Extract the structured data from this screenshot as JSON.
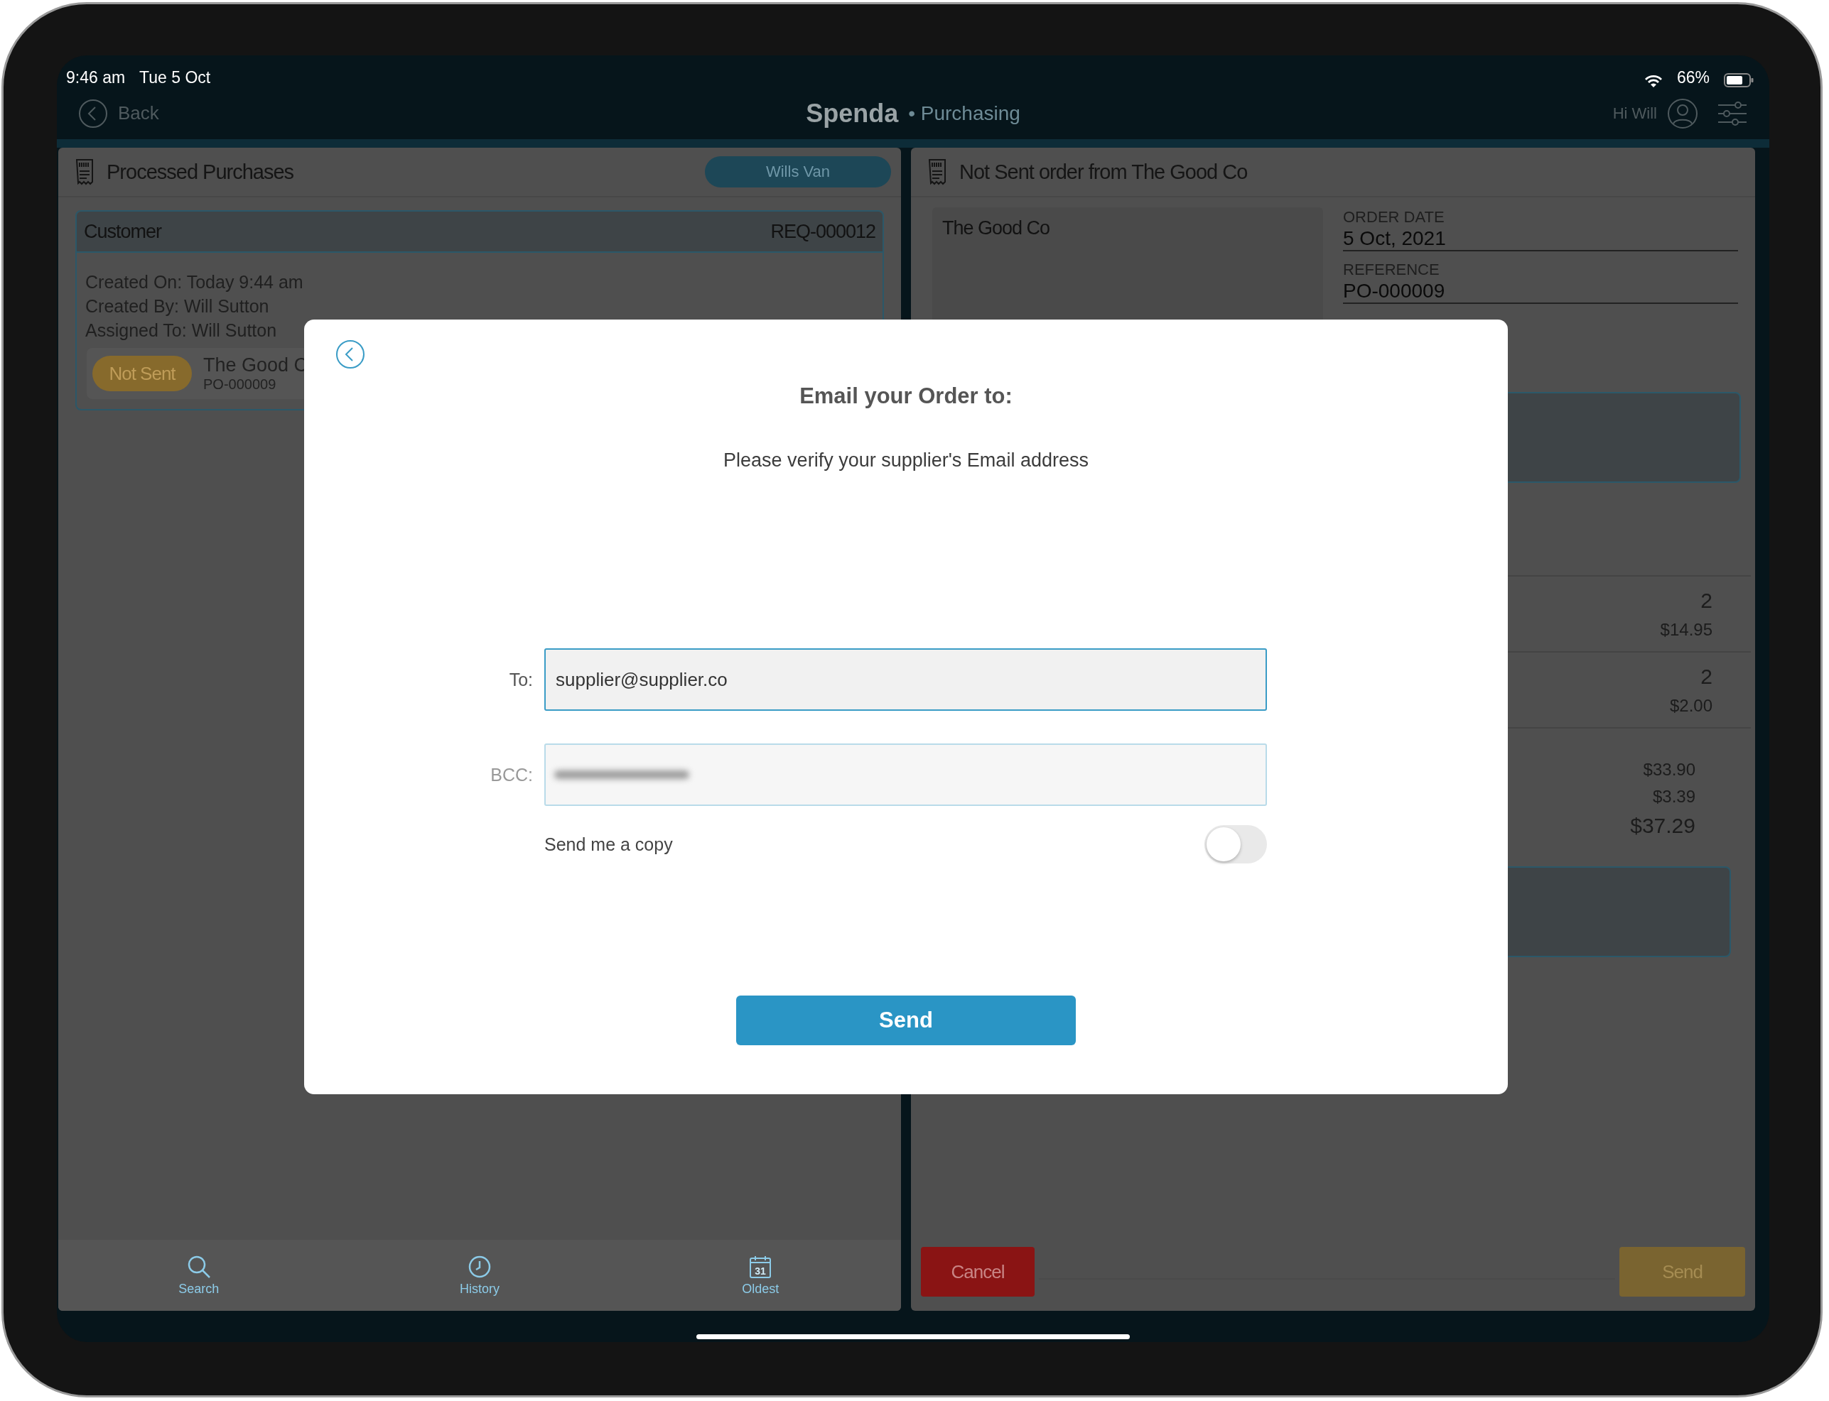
{
  "status_bar": {
    "time": "9:46 am",
    "date": "Tue 5 Oct",
    "battery": "66%"
  },
  "header": {
    "back": "Back",
    "brand": "Spenda",
    "module": "• Purchasing",
    "greeting": "Hi Will"
  },
  "left_panel": {
    "title": "Processed Purchases",
    "filter_button": "Wills Van",
    "card": {
      "customer_label": "Customer",
      "requisition": "REQ-000012",
      "details": [
        "Created On: Today 9:44 am",
        "Created By: Will Sutton",
        "Assigned To: Will Sutton"
      ],
      "order": {
        "status": "Not Sent",
        "supplier": "The Good C",
        "number": "PO-000009"
      }
    }
  },
  "bottom_tabs": [
    {
      "label": "Search",
      "kind": "search"
    },
    {
      "label": "History",
      "kind": "history"
    },
    {
      "label": "Oldest",
      "kind": "calendar",
      "icon_text": "31"
    }
  ],
  "right_panel": {
    "title": "Not Sent order from The Good Co",
    "supplier": "The Good Co",
    "fields": [
      {
        "label": "ORDER DATE",
        "value": "5 Oct, 2021"
      },
      {
        "label": "REFERENCE",
        "value": "PO-000009"
      }
    ],
    "lines": [
      {
        "quantity": "2",
        "price": "$14.95"
      },
      {
        "quantity": "2",
        "price": "$2.00"
      }
    ],
    "totals": [
      "$33.90",
      "$3.39",
      "$37.29"
    ],
    "cancel_button": "Cancel",
    "send_button": "Send"
  },
  "dialog": {
    "title": "Email your Order to:",
    "subtitle": "Please verify your supplier's Email address",
    "to": {
      "label": "To:",
      "value": "supplier@supplier.co"
    },
    "bcc": {
      "label": "BCC:"
    },
    "copy": {
      "label": "Send me a copy",
      "on": false
    },
    "send_button": "Send"
  }
}
